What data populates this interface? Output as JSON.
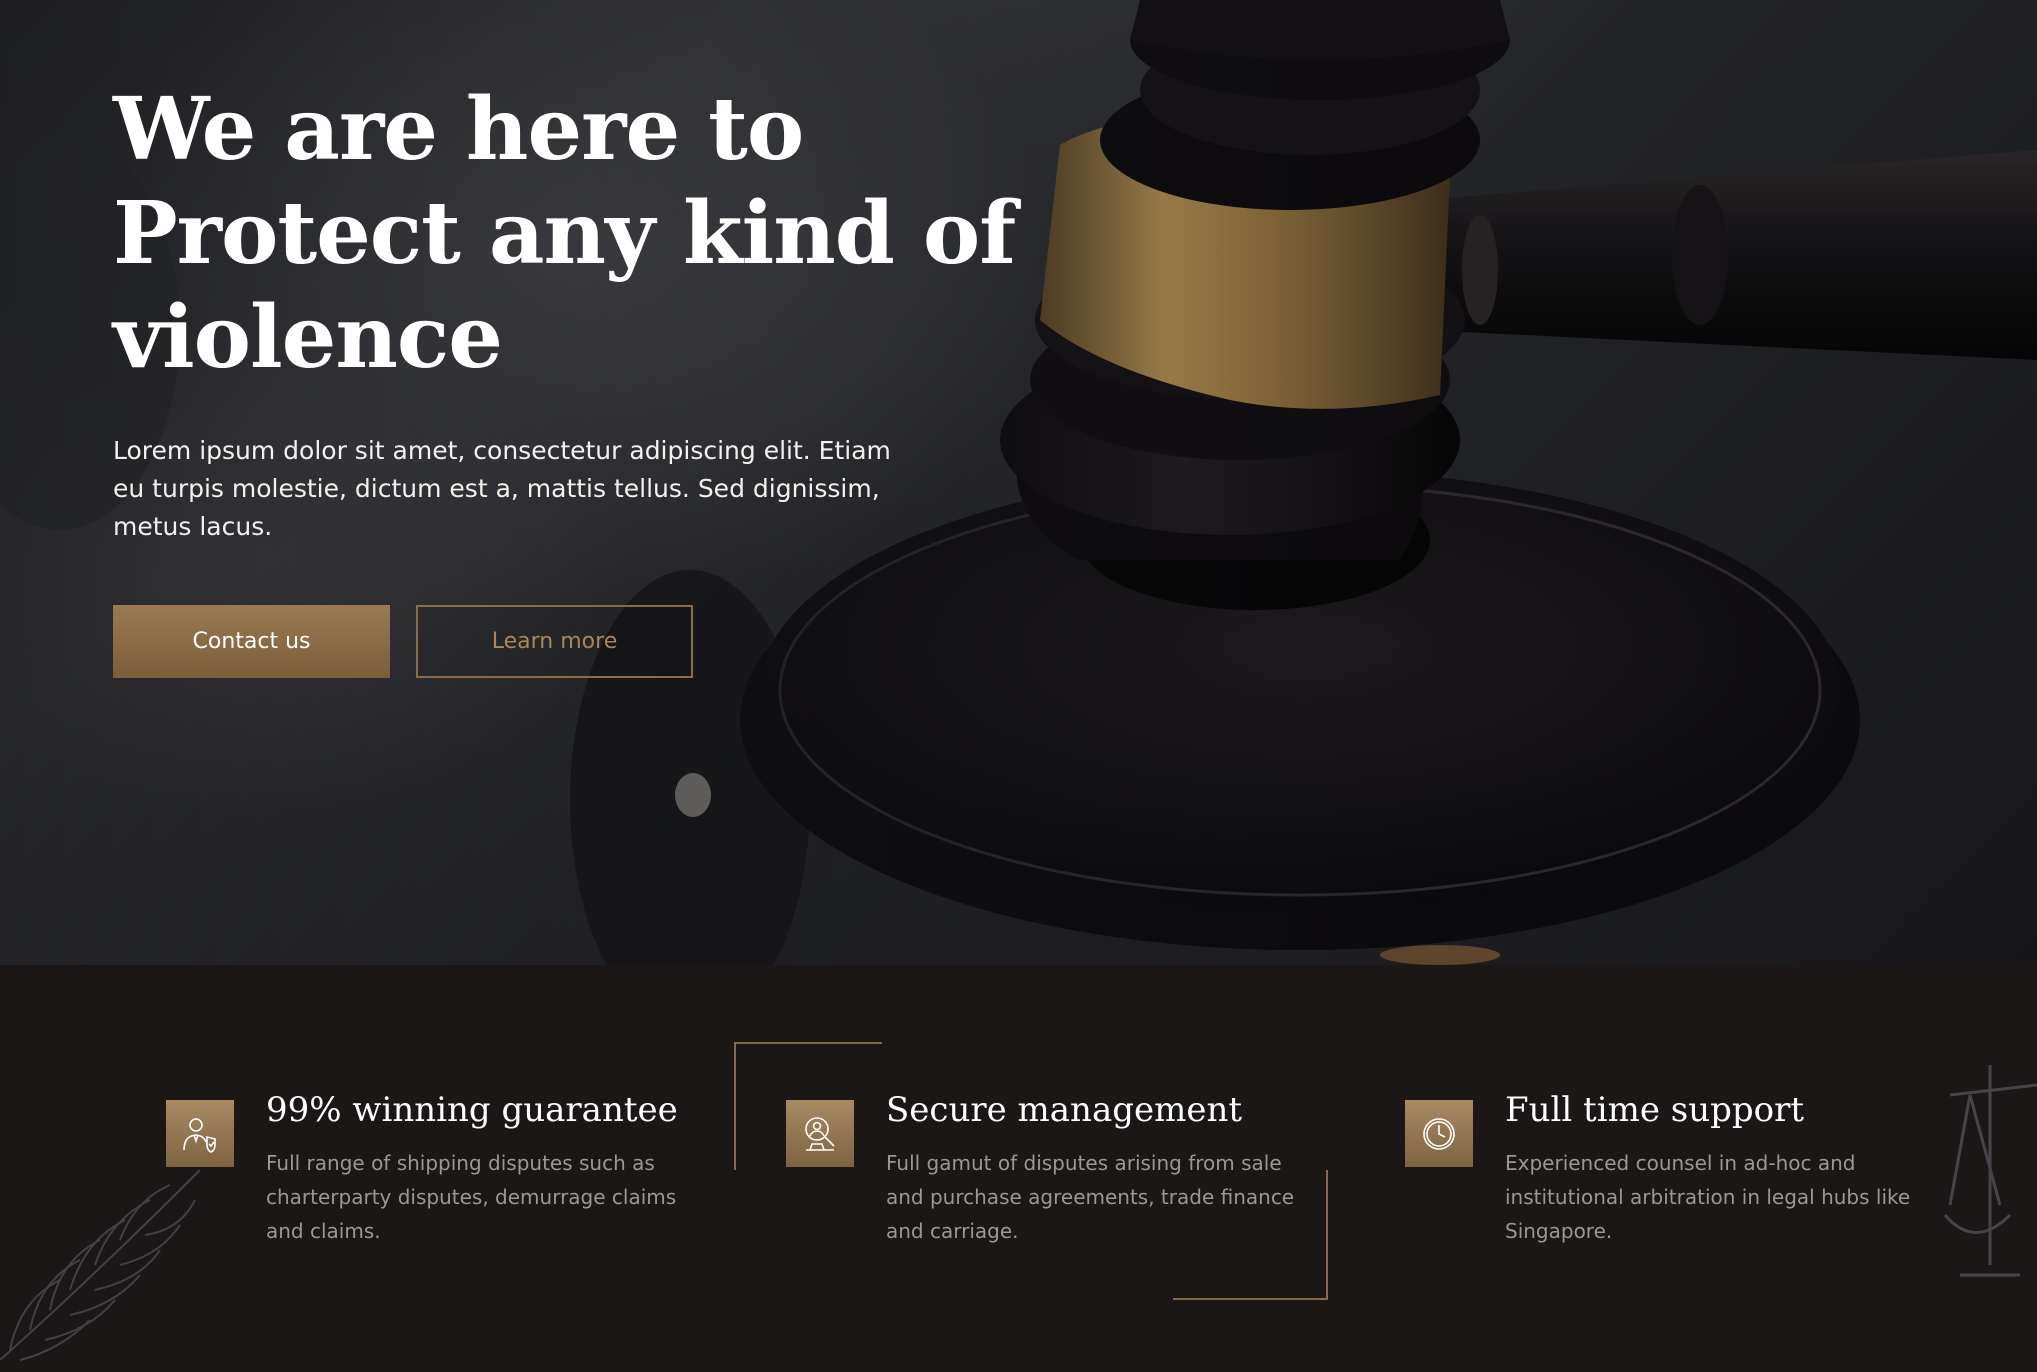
{
  "hero": {
    "headline": {
      "line1": "We are here to",
      "highlight": "Protect",
      "line2_rest": " any kind of",
      "line3": "violence"
    },
    "description": "Lorem ipsum dolor sit amet, consectetur adipiscing elit. Etiam eu turpis molestie, dictum est a, mattis tellus. Sed dignissim, metus  lacus.",
    "buttons": {
      "contact_label": "Contact us",
      "learn_label": "Learn more"
    }
  },
  "features": {
    "items": [
      {
        "icon": "lawyer-shield-icon",
        "title": "99% winning guarantee",
        "text": "Full range of shipping disputes such as charterparty disputes, demurrage claims and claims."
      },
      {
        "icon": "magnifier-person-icon",
        "title": "Secure management",
        "text": "Full gamut of disputes arising from sale and purchase agreements, trade finance and carriage."
      },
      {
        "icon": "clock-icon",
        "title": "Full time support",
        "text": "Experienced counsel in ad-hoc and institutional arbitration in legal hubs like Singapore."
      }
    ]
  },
  "colors": {
    "accent_gold": "#9a7a52",
    "background_dark": "#1b1716",
    "text_muted": "#9c9794"
  }
}
